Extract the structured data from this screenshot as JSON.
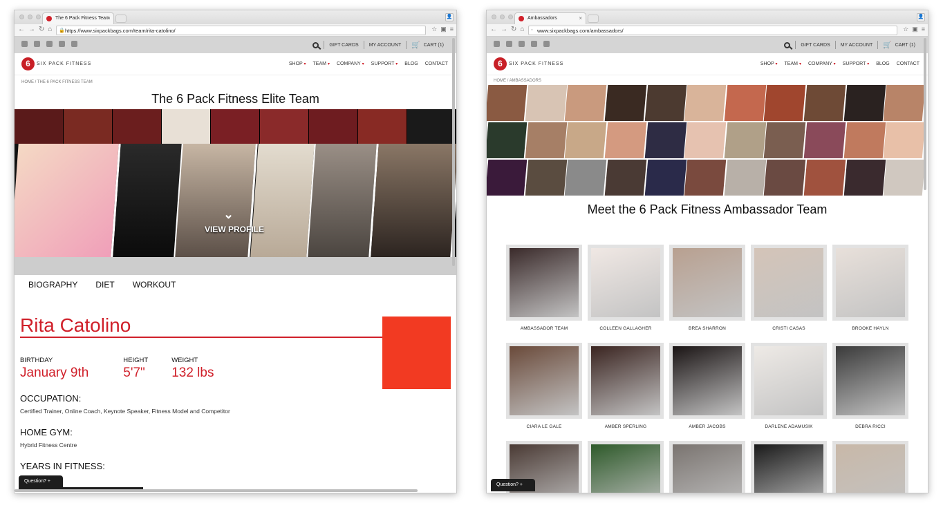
{
  "left_window": {
    "tab_title": "The 6 Pack Fitness Team",
    "url": "https://www.sixpackbags.com/team/rita-catolino/",
    "utility_links": [
      "GIFT CARDS",
      "MY ACCOUNT",
      "CART (1)"
    ],
    "logo_text": "SIX PACK FITNESS",
    "menu": [
      "SHOP",
      "TEAM",
      "COMPANY",
      "SUPPORT",
      "BLOG",
      "CONTACT"
    ],
    "breadcrumb": "HOME  /  THE 6 PACK FITNESS TEAM",
    "heading": "The 6 Pack Fitness Elite Team",
    "hero_cta": "VIEW PROFILE",
    "profile_tabs": [
      "BIOGRAPHY",
      "DIET",
      "WORKOUT"
    ],
    "profile": {
      "name": "Rita Catolino",
      "birthday_label": "BIRTHDAY",
      "birthday": "January 9th",
      "height_label": "HEIGHT",
      "height": "5'7\"",
      "weight_label": "WEIGHT",
      "weight": "132 lbs",
      "occupation_label": "OCCUPATION:",
      "occupation": "Certified Trainer, Online Coach, Keynote Speaker, Fitness Model and Competitor",
      "gym_label": "HOME GYM:",
      "gym": "Hybrid Fitness Centre",
      "years_label": "YEARS IN FITNESS:"
    },
    "question_label": "Question?  +"
  },
  "right_window": {
    "tab_title": "Ambassadors",
    "url": "www.sixpackbags.com/ambassadors/",
    "utility_links": [
      "GIFT CARDS",
      "MY ACCOUNT",
      "CART (1)"
    ],
    "logo_text": "SIX PACK FITNESS",
    "menu": [
      "SHOP",
      "TEAM",
      "COMPANY",
      "SUPPORT",
      "BLOG",
      "CONTACT"
    ],
    "breadcrumb": "HOME  /  AMBASSADORS",
    "heading": "Meet the 6 Pack Fitness Ambassador Team",
    "ambassadors": [
      "AMBASSADOR TEAM",
      "COLLEEN GALLAGHER",
      "BREA SHARRON",
      "CRISTI CASAS",
      "BROOKE HAYLN",
      "CIARA LE GALE",
      "AMBER SPERLING",
      "AMBER JACOBS",
      "DARLENE ADAMUSIK",
      "DEBRA RICCI",
      "",
      "",
      "",
      "",
      ""
    ],
    "question_label": "Question?  +"
  },
  "colors": {
    "brand_red": "#d0202a",
    "accent_orange": "#f23a22",
    "util_gray": "#d5d5d5"
  },
  "icons": [
    "facebook-icon",
    "twitter-icon",
    "pinterest-icon",
    "youtube-icon",
    "instagram-icon",
    "search-icon",
    "cart-icon"
  ]
}
